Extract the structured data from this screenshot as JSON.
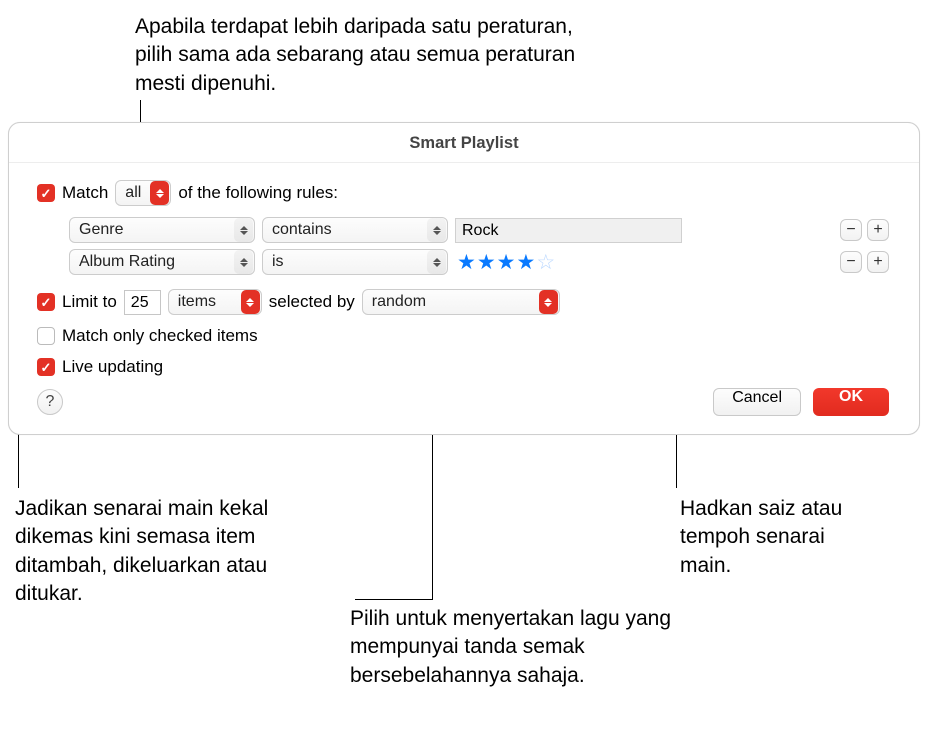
{
  "dialog": {
    "title": "Smart Playlist",
    "match": {
      "label_before": "Match",
      "mode": "all",
      "label_after": "of the following rules:",
      "checked": true
    },
    "rules": [
      {
        "field": "Genre",
        "operator": "contains",
        "value": "Rock",
        "value_type": "text"
      },
      {
        "field": "Album Rating",
        "operator": "is",
        "value": 4,
        "value_type": "stars",
        "max": 5
      }
    ],
    "limit": {
      "checked": true,
      "label": "Limit to",
      "value": "25",
      "unit": "items",
      "selected_by_label": "selected by",
      "method": "random"
    },
    "match_only": {
      "checked": false,
      "label": "Match only checked items"
    },
    "live": {
      "checked": true,
      "label": "Live updating"
    },
    "buttons": {
      "help": "?",
      "cancel": "Cancel",
      "ok": "OK"
    }
  },
  "callouts": {
    "top": "Apabila terdapat lebih daripada satu peraturan, pilih sama ada sebarang atau semua peraturan mesti dipenuhi.",
    "bottom_left": "Jadikan senarai main kekal dikemas kini semasa item ditambah, dikeluarkan atau ditukar.",
    "bottom_middle": "Pilih untuk menyertakan lagu yang mempunyai tanda semak bersebelahannya sahaja.",
    "bottom_right": "Hadkan saiz atau tempoh senarai main."
  }
}
